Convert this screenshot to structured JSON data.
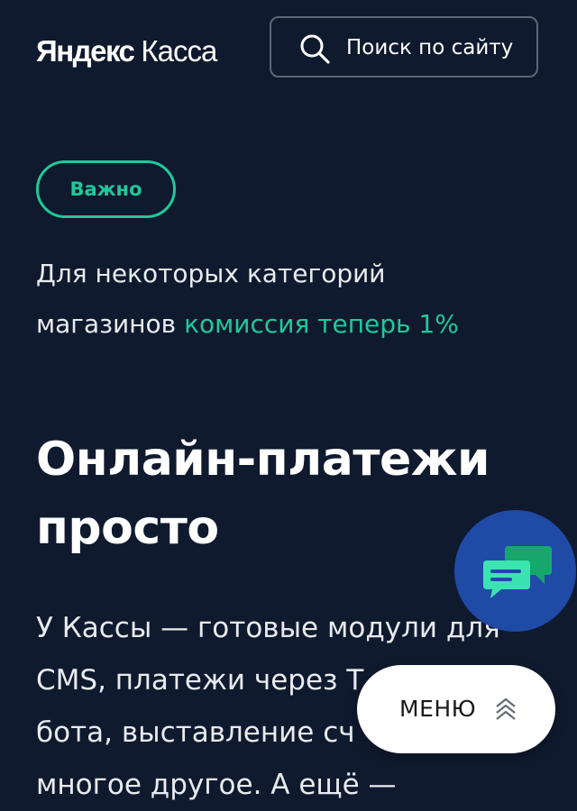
{
  "header": {
    "logo_brand": "Яндекс",
    "logo_product": "Касса",
    "search_label": "Поиск по сайту",
    "search_icon": "search-icon"
  },
  "badge": {
    "label": "Важно",
    "color": "#1fc99a"
  },
  "notice": {
    "text_line1": "Для некоторых категорий",
    "text_line2": "магазинов",
    "link_text": "комиссия теперь 1%"
  },
  "hero": {
    "title_line1": "Онлайн-платежи",
    "title_line2": "просто"
  },
  "description": {
    "lines": [
      "У Кассы — готовые модули для",
      "CMS, платежи через Т",
      "бота, выставление сч",
      "многое другое. А ещё —"
    ]
  },
  "chat": {
    "icon": "chat-icon",
    "background": "#1f4aa6",
    "bubble_colors": [
      "#15a86a",
      "#3be3b0"
    ]
  },
  "menu": {
    "label": "МЕНЮ",
    "icon": "chevrons-up-icon"
  },
  "colors": {
    "background": "#0f1a2e",
    "accent": "#1fc99a",
    "text": "#ffffff"
  }
}
